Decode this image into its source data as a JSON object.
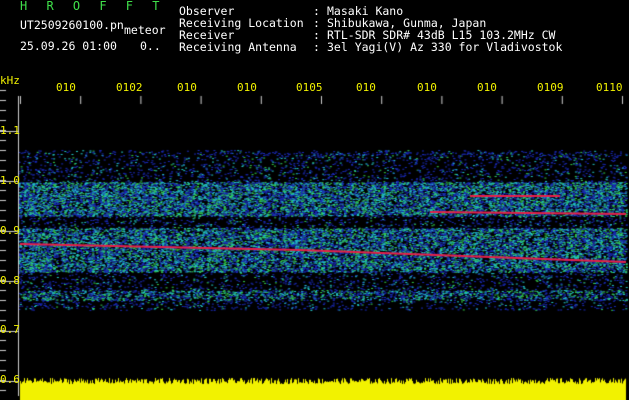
{
  "header": {
    "app_title": "H R O F F T",
    "filename": "UT2509260100.pn",
    "filename_suffix": "meteor",
    "date_time": "25.09.26 01:00",
    "extra": "0..",
    "info": [
      {
        "label": "Observer",
        "value": "Masaki Kano"
      },
      {
        "label": "Receiving Location",
        "value": "Shibukawa, Gunma, Japan"
      },
      {
        "label": "Receiver",
        "value": "RTL-SDR SDR# 43dB L15 103.2MHz CW"
      },
      {
        "label": "Receiving Antenna",
        "value": "3el Yagi(V) Az 330 for Vladivostok"
      }
    ],
    "colon": ":"
  },
  "axis": {
    "unit": "kHz",
    "freq_labels": [
      "1.1",
      "1.0",
      "0.9",
      "0.8",
      "0.7",
      "0.6"
    ],
    "minute_labels": [
      "010",
      "0102",
      "010",
      "010",
      "0105",
      "010",
      "010",
      "010",
      "0109",
      "0110"
    ]
  },
  "colors": {
    "background": "#000000",
    "noise_blue": "#1a2ab8",
    "signal_cyan": "#23c7c7",
    "signal_green": "#35d04a",
    "signal_red": "#e8204a",
    "signal_yellow": "#f2f200"
  }
}
